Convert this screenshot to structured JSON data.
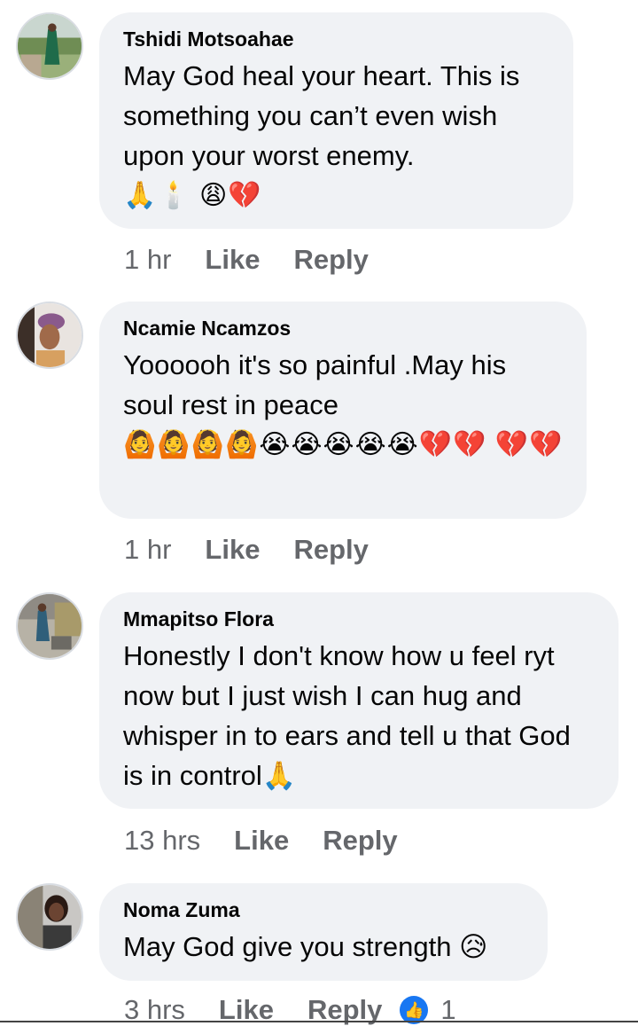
{
  "comments": [
    {
      "author": "Tshidi Motsoahae",
      "text": "May God heal your heart. This is something you can’t even wish upon your worst enemy.",
      "emojis": "🙏🕯️ 😩💔",
      "time": "1 hr",
      "like_label": "Like",
      "reply_label": "Reply"
    },
    {
      "author": "Ncamie Ncamzos",
      "text": "Yoooooh it's so painful .May his soul rest in peace",
      "emojis": "🙆🙆🙆🙆😭😭😭😭😭💔💔 💔💔",
      "time": "1 hr",
      "like_label": "Like",
      "reply_label": "Reply"
    },
    {
      "author": "Mmapitso Flora",
      "text": "Honestly I don't know how u feel ryt now but I just wish I can hug and whisper in to ears and tell u that God is in control🙏",
      "time": "13 hrs",
      "like_label": "Like",
      "reply_label": "Reply"
    },
    {
      "author": "Noma Zuma",
      "text": "May God give you strength 😥",
      "time": "3 hrs",
      "like_label": "Like",
      "reply_label": "Reply",
      "reaction_icon": "thumbs-up-icon",
      "reaction_count": "1"
    }
  ],
  "colors": {
    "bubble": "#f0f2f5",
    "meta_text": "#65676b",
    "like_badge": "#1877f2"
  }
}
